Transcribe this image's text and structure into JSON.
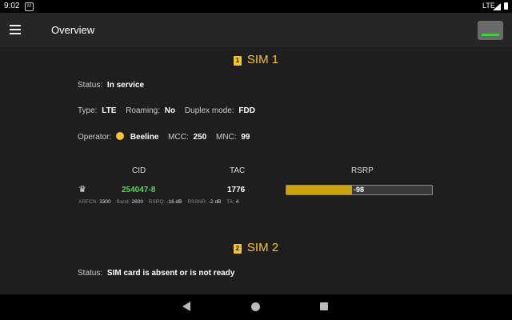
{
  "statusbar": {
    "time": "9:02",
    "notif": "M",
    "network": "LTE"
  },
  "appbar": {
    "title": "Overview"
  },
  "sim1": {
    "title": "SIM 1",
    "badge": "1",
    "status_label": "Status:",
    "status_value": "In service",
    "type_label": "Type:",
    "type_value": "LTE",
    "roaming_label": "Roaming:",
    "roaming_value": "No",
    "duplex_label": "Duplex mode:",
    "duplex_value": "FDD",
    "operator_label": "Operator:",
    "operator_value": "Beeline",
    "mcc_label": "MCC:",
    "mcc_value": "250",
    "mnc_label": "MNC:",
    "mnc_value": "99",
    "columns": {
      "cid": "CID",
      "tac": "TAC",
      "rsrp": "RSRP"
    },
    "cell": {
      "cid": "254047-8",
      "tac": "1776",
      "rsrp": "-98",
      "rsrp_level": 0.45,
      "arfcn_label": "ARFCN:",
      "arfcn": "3300",
      "band_label": "Band:",
      "band": "2600",
      "rsrq_label": "RSRQ:",
      "rsrq": "-16 dB",
      "rssnr_label": "RSSNR:",
      "rssnr": "-2 dB",
      "ta_label": "TA:",
      "ta": "4"
    }
  },
  "sim2": {
    "title": "SIM 2",
    "badge": "2",
    "status_label": "Status:",
    "status_value": "SIM card is absent or is not ready"
  },
  "colors": {
    "accent": "#f4c430",
    "cid": "#5ad45a",
    "bar": "#c9a20e",
    "background": "#1e1e1e"
  },
  "icons": {
    "menu": "hamburger-icon",
    "serving": "crown-icon",
    "operator": "beeline-logo-icon"
  }
}
